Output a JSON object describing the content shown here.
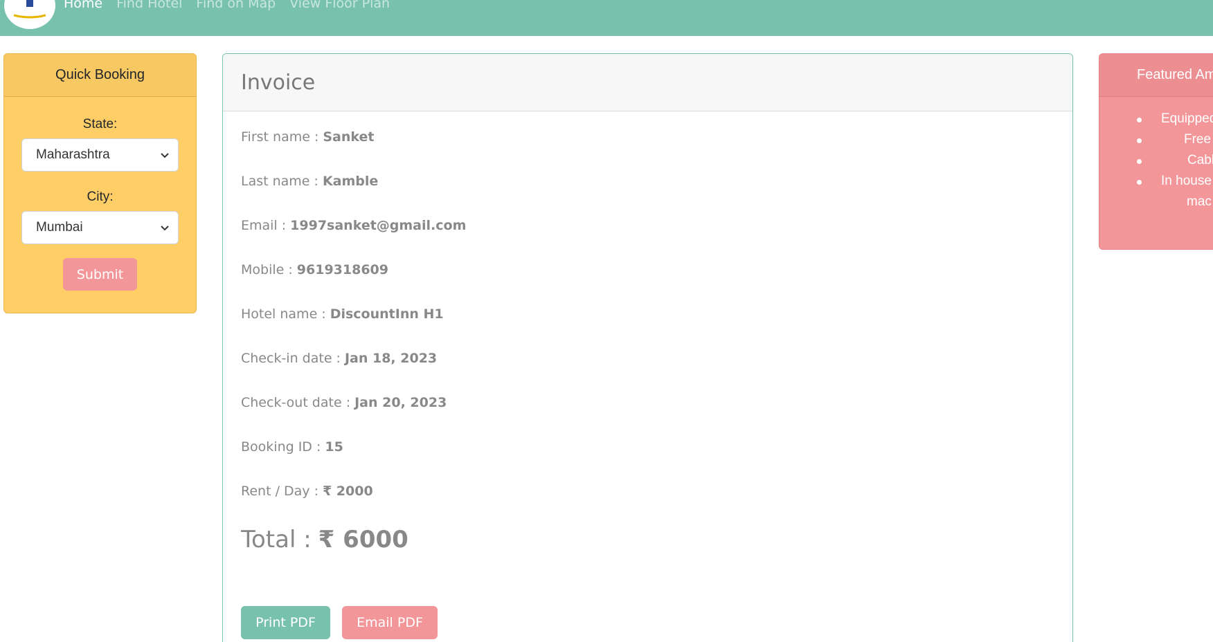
{
  "navbar": {
    "links": [
      {
        "label": "Home",
        "active": true
      },
      {
        "label": "Find Hotel"
      },
      {
        "label": "Find on Map"
      },
      {
        "label": "View Floor Plan"
      }
    ],
    "logo_icon": "hotel-logo-icon",
    "color": "#78c2ad"
  },
  "quick_booking": {
    "title": "Quick Booking",
    "state_label": "State:",
    "state_value": "Maharashtra",
    "city_label": "City:",
    "city_value": "Mumbai",
    "submit_label": "Submit"
  },
  "invoice": {
    "title": "Invoice",
    "fields": [
      {
        "label": "First name :",
        "value": "Sanket"
      },
      {
        "label": "Last name :",
        "value": "Kamble"
      },
      {
        "label": "Email :",
        "value": "1997sanket@gmail.com"
      },
      {
        "label": "Mobile :",
        "value": "9619318609"
      },
      {
        "label": "Hotel name :",
        "value": "DiscountInn H1"
      },
      {
        "label": "Check-in date :",
        "value": "Jan 18, 2023"
      },
      {
        "label": "Check-out date :",
        "value": "Jan 20, 2023"
      },
      {
        "label": "Booking ID :",
        "value": "15"
      },
      {
        "label": "Rent / Day :",
        "value": "₹ 2000"
      }
    ],
    "total_label": "Total :",
    "total_value": "₹ 6000",
    "print_label": "Print PDF",
    "email_label": "Email PDF"
  },
  "featured": {
    "title": "Featured Am",
    "items": [
      {
        "text": "Equipped"
      },
      {
        "text": "Free"
      },
      {
        "text": "Cabl"
      },
      {
        "text": "In house",
        "cont": "mac"
      }
    ]
  },
  "colors": {
    "primary": "#78c2ad",
    "warning": "#ffce67",
    "secondary": "#f3969a"
  }
}
